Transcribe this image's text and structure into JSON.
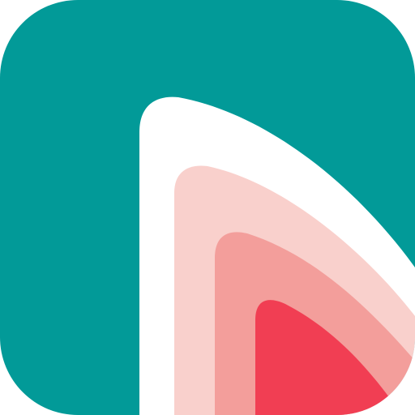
{
  "icon": {
    "name": "app-launcher-icon",
    "colors": {
      "background": "#FFFFFF",
      "tile": "#029A98",
      "sail_outer": "#FFFFFF",
      "layer_light": "#F9D0CC",
      "layer_mid": "#F39E9B",
      "layer_core": "#F13E53"
    }
  }
}
